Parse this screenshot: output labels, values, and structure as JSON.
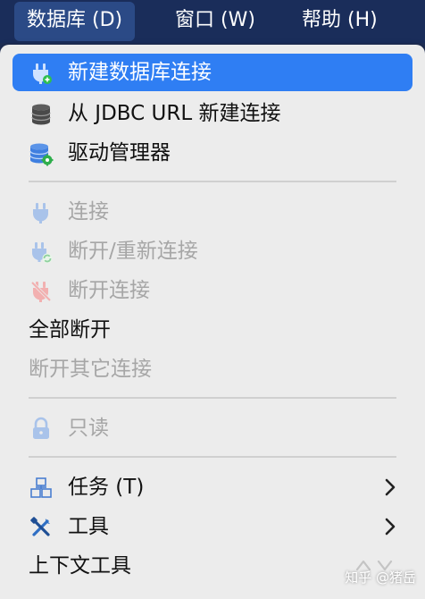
{
  "menubar": {
    "items": [
      {
        "label": "数据库 (D)",
        "active": true
      },
      {
        "label": "窗口 (W)",
        "active": false
      },
      {
        "label": "帮助 (H)",
        "active": false
      }
    ]
  },
  "menu": {
    "new_connection": "新建数据库连接",
    "new_from_jdbc": "从 JDBC URL 新建连接",
    "driver_manager": "驱动管理器",
    "connect": "连接",
    "disconnect_reconnect": "断开/重新连接",
    "disconnect": "断开连接",
    "disconnect_all": "全部断开",
    "disconnect_others": "断开其它连接",
    "read_only": "只读",
    "tasks": "任务 (T)",
    "tools": "工具",
    "context_tools": "上下文工具"
  },
  "watermark": "知乎 @猪岳",
  "colors": {
    "menubar_bg": "#1a2d5a",
    "active_menu_bg": "#2b4a86",
    "highlight": "#2f7ef3",
    "menu_bg": "#ececec",
    "disabled_text": "#a6a6a6",
    "plug_blue": "#4a7fd0"
  },
  "icons": {
    "new_connection": "plug-plus-icon",
    "new_from_jdbc": "database-icon",
    "driver_manager": "database-gear-icon",
    "connect": "plug-icon",
    "disconnect_reconnect": "plug-refresh-icon",
    "disconnect": "plug-disconnect-icon",
    "read_only": "lock-icon",
    "tasks": "tasks-boxes-icon",
    "tools": "tools-icon"
  }
}
